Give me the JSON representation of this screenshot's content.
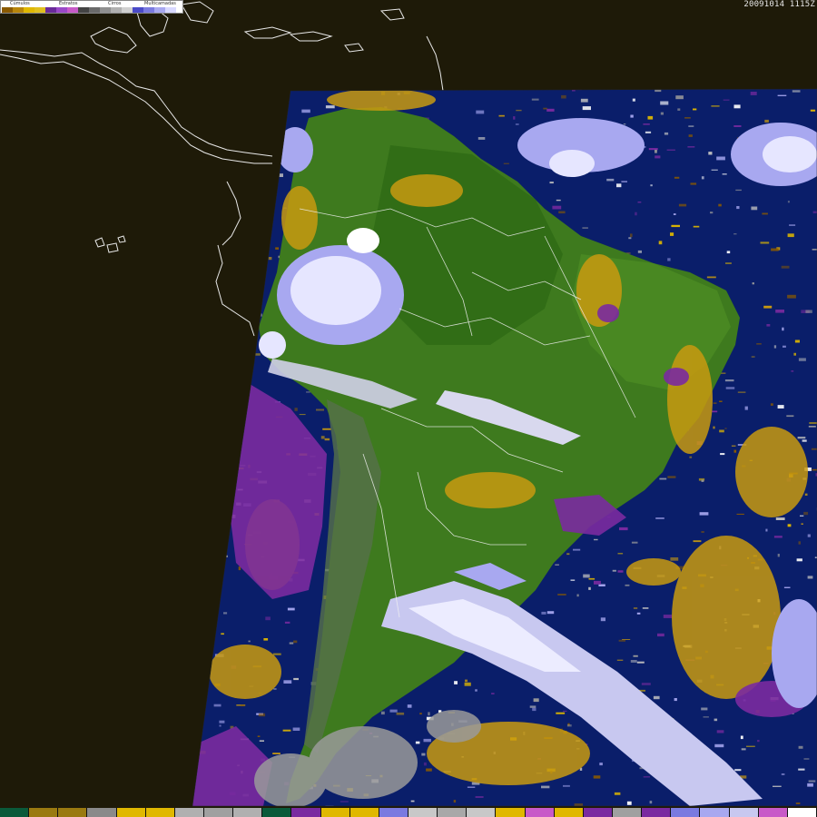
{
  "timestamp": "20091014  1115Z",
  "legend": {
    "groups": [
      {
        "label": "Cúmulos"
      },
      {
        "label": "Estratos"
      },
      {
        "label": "Cirros"
      },
      {
        "label": "Multicamadas"
      }
    ],
    "swatch_colors": [
      "#8a5a00",
      "#b8860b",
      "#e0b800",
      "#e0c020",
      "#6a2a9a",
      "#9a48c8",
      "#c85ac8",
      "#444444",
      "#6a6a6a",
      "#909090",
      "#b0b0b0",
      "#d0d0d0",
      "#4a4ac8",
      "#7a7ae0",
      "#a8a8f0",
      "#d8d8ff"
    ]
  },
  "colorbar": [
    "#0a5a3a",
    "#9a7a10",
    "#9a7a10",
    "#8a8a8a",
    "#e0b800",
    "#e0b800",
    "#b0b0b0",
    "#a0a0a0",
    "#b0b0b0",
    "#0a5a3a",
    "#7a2aa0",
    "#e0b800",
    "#e0b800",
    "#7a7ae0",
    "#c8c8c8",
    "#a8a8a8",
    "#c8c8c8",
    "#e0b800",
    "#c85ac8",
    "#e0b800",
    "#7a2aa0",
    "#a0a0a0",
    "#7a2aa0",
    "#7a7ae0",
    "#a8a8f0",
    "#c8c8f0",
    "#c85ac8",
    "#ffffff"
  ],
  "colors": {
    "background": "#1e1a08",
    "ocean": "#0a1e6a",
    "land": "#3e7a1e",
    "cloud_white": "#e6e6ff",
    "cloud_lavender": "#a8a8f0",
    "cumulus_gold": "#c89a10",
    "stratus_purple": "#7a2aa0",
    "gray": "#9a9a9a",
    "borders": "#ffffff"
  }
}
